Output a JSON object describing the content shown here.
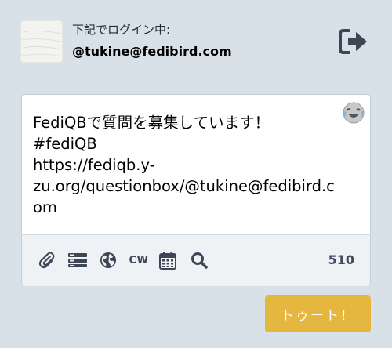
{
  "account": {
    "login_label": "下記でログイン中:",
    "handle": "@tukine@fedibird.com",
    "avatar_icon": "avatar-image",
    "logout_icon": "sign-out-icon"
  },
  "compose": {
    "text": "FediQBで質問を募集しています！\n#fediQB\nhttps://fediqb.y-\nzu.org/questionbox/@tukine@fedibird.c\nom",
    "emoji_icon": "laughing-with-tears-emoji"
  },
  "toolbar": {
    "icons": [
      "paperclip-icon",
      "tasks-icon",
      "globe-icon",
      "cw-icon",
      "calendar-icon",
      "search-icon"
    ],
    "cw_label": "CW",
    "char_count": "510"
  },
  "submit": {
    "label": "トゥート！",
    "color": "#e5b73f"
  }
}
